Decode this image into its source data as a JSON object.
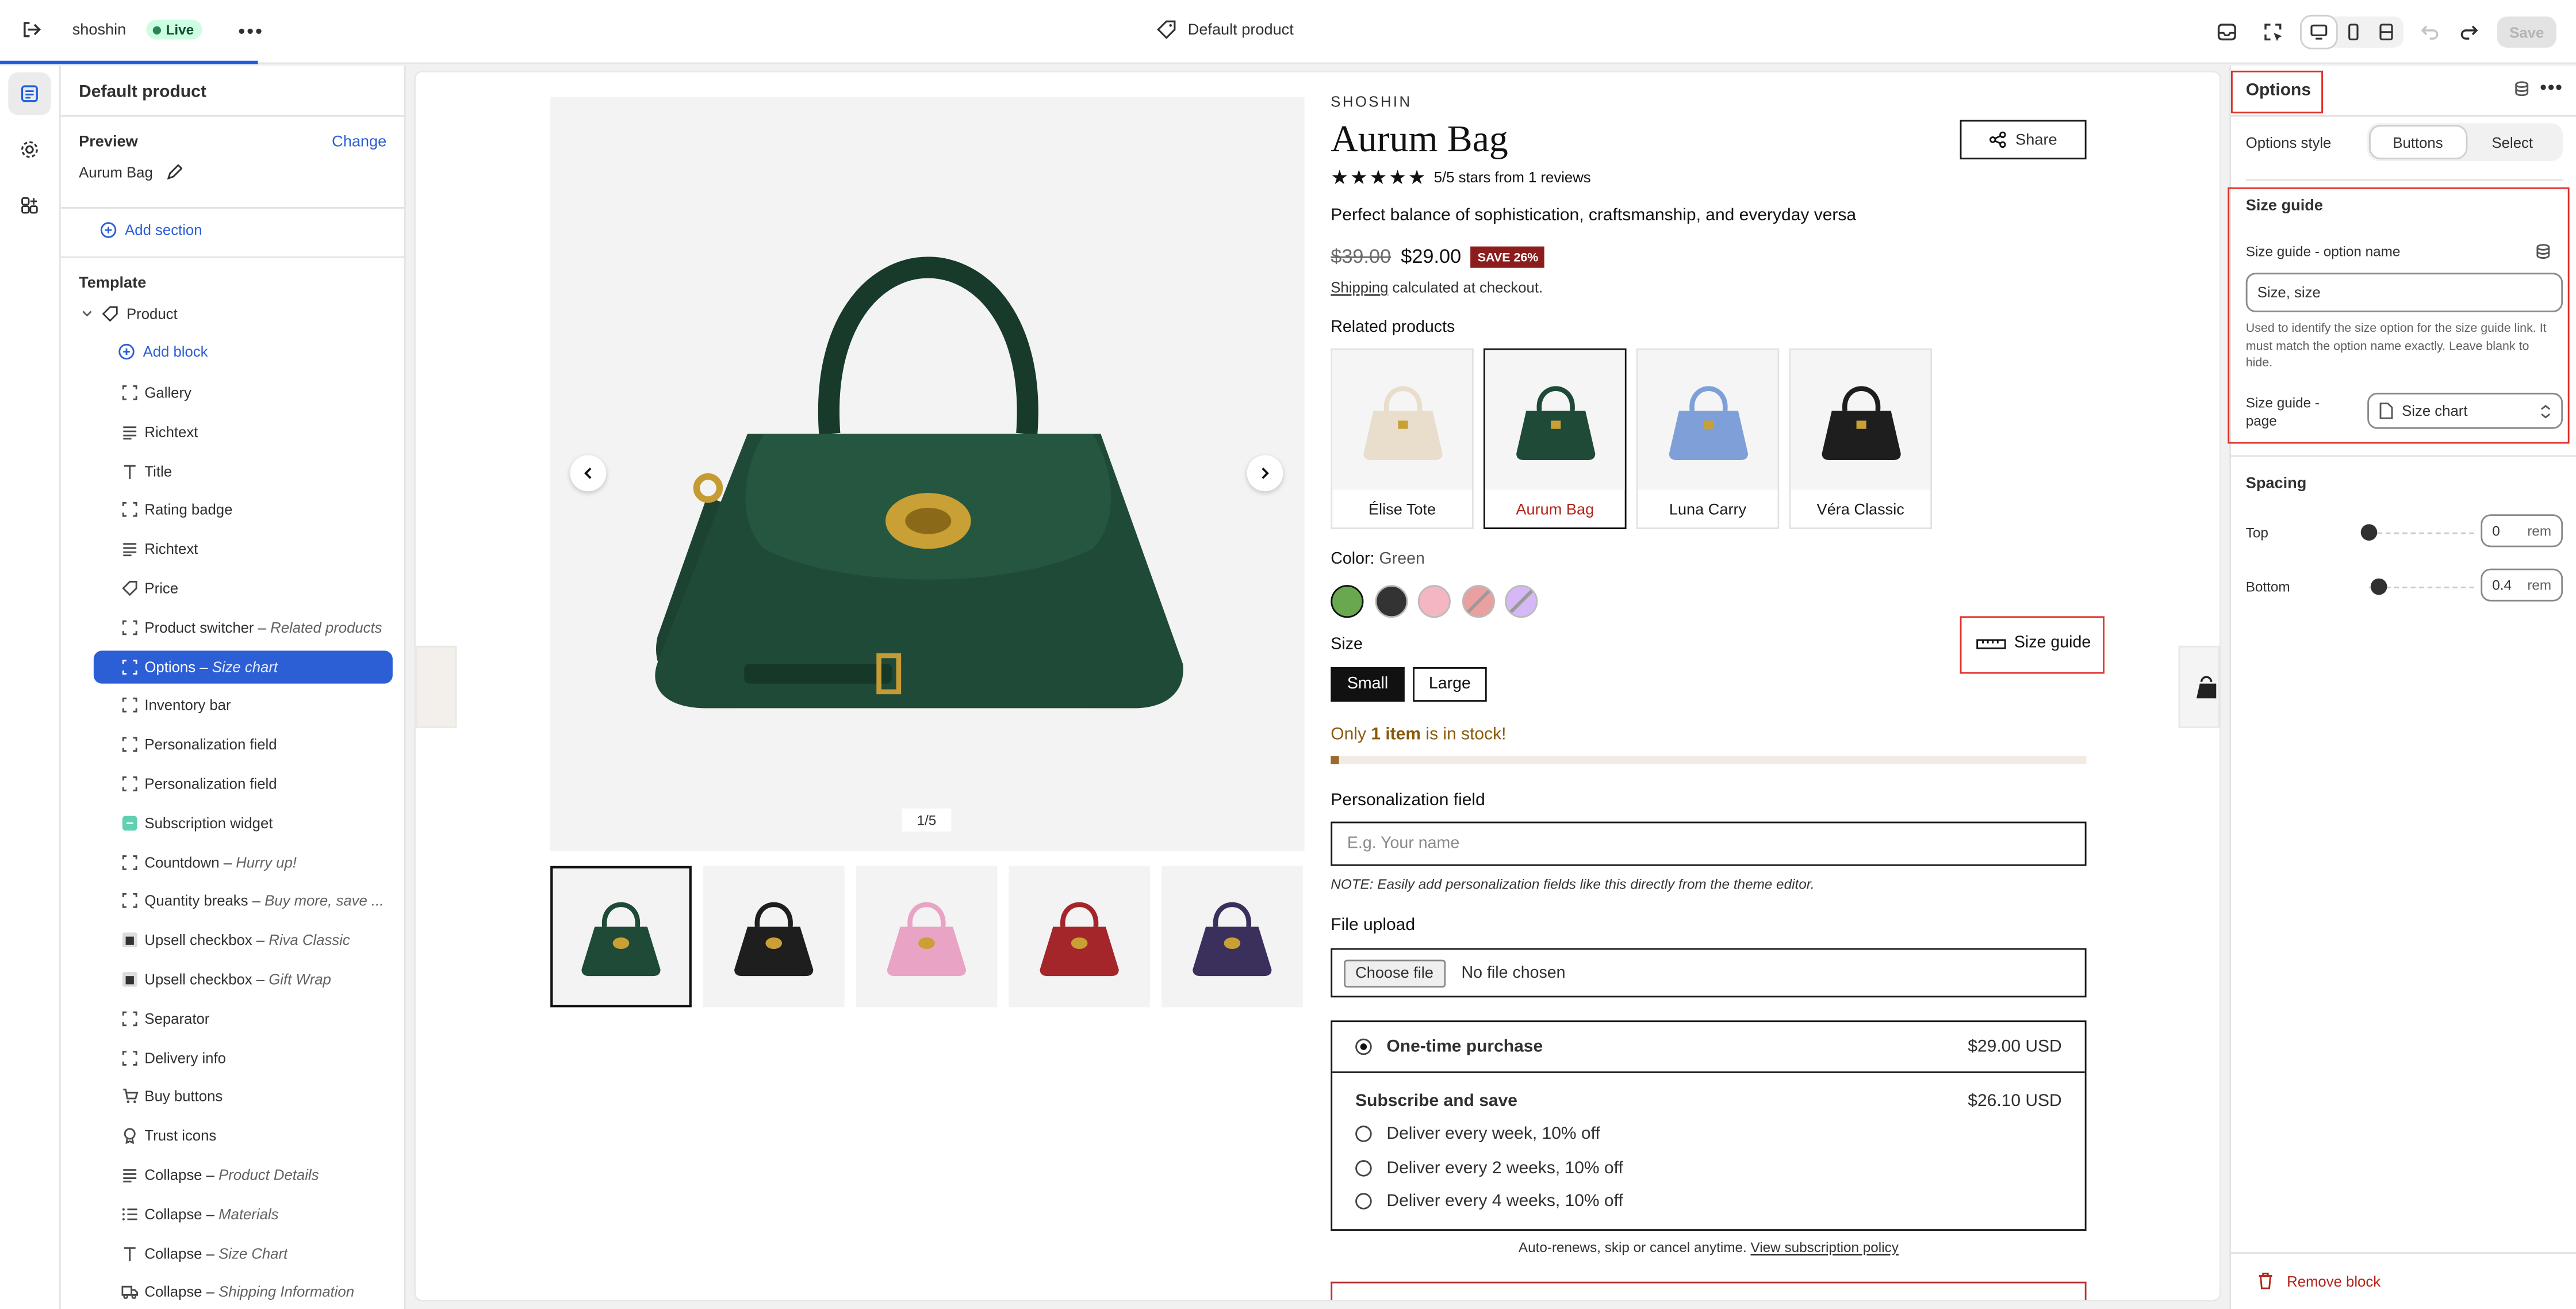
{
  "topbar": {
    "store_name": "shoshin",
    "status_badge": "Live",
    "page_selector": "Default product",
    "save_label": "Save"
  },
  "left_panel": {
    "title": "Default product",
    "preview_label": "Preview",
    "change_link": "Change",
    "preview_product": "Aurum Bag",
    "add_section": "Add section",
    "template_label": "Template",
    "product_label": "Product",
    "add_block": "Add block",
    "blocks": [
      {
        "label": "Gallery",
        "detail": "",
        "icon": "frame-icon"
      },
      {
        "label": "Richtext",
        "detail": "",
        "icon": "text-lines-icon"
      },
      {
        "label": "Title",
        "detail": "",
        "icon": "title-icon"
      },
      {
        "label": "Rating badge",
        "detail": "",
        "icon": "frame-icon"
      },
      {
        "label": "Richtext",
        "detail": "",
        "icon": "text-lines-icon"
      },
      {
        "label": "Price",
        "detail": "",
        "icon": "price-tag-icon"
      },
      {
        "label": "Product switcher",
        "detail": "Related products",
        "icon": "frame-icon"
      },
      {
        "label": "Options",
        "detail": "Size chart",
        "icon": "frame-icon",
        "selected": true
      },
      {
        "label": "Inventory bar",
        "detail": "",
        "icon": "frame-icon"
      },
      {
        "label": "Personalization field",
        "detail": "",
        "icon": "frame-icon"
      },
      {
        "label": "Personalization field",
        "detail": "",
        "icon": "frame-icon"
      },
      {
        "label": "Subscription widget",
        "detail": "",
        "icon": "app-icon"
      },
      {
        "label": "Countdown",
        "detail": "Hurry up!",
        "icon": "frame-icon"
      },
      {
        "label": "Quantity breaks",
        "detail": "Buy more, save ...",
        "icon": "frame-icon"
      },
      {
        "label": "Upsell checkbox",
        "detail": "Riva Classic",
        "icon": "product-icon"
      },
      {
        "label": "Upsell checkbox",
        "detail": "Gift Wrap",
        "icon": "product-icon"
      },
      {
        "label": "Separator",
        "detail": "",
        "icon": "frame-icon"
      },
      {
        "label": "Delivery info",
        "detail": "",
        "icon": "frame-icon"
      },
      {
        "label": "Buy buttons",
        "detail": "",
        "icon": "cart-icon"
      },
      {
        "label": "Trust icons",
        "detail": "",
        "icon": "badge-icon"
      },
      {
        "label": "Collapse",
        "detail": "Product Details",
        "icon": "text-lines-icon"
      },
      {
        "label": "Collapse",
        "detail": "Materials",
        "icon": "list-icon"
      },
      {
        "label": "Collapse",
        "detail": "Size Chart",
        "icon": "title-icon"
      },
      {
        "label": "Collapse",
        "detail": "Shipping Information",
        "icon": "truck-icon"
      }
    ]
  },
  "product": {
    "vendor": "SHOSHIN",
    "title": "Aurum Bag",
    "share_label": "Share",
    "stars": "★★★★★",
    "rating_text": "5/5 stars from 1 reviews",
    "tagline": "Perfect balance of sophistication, craftsmanship, and everyday versa",
    "compare_price": "$39.00",
    "price": "$29.00",
    "save_badge": "SAVE 26%",
    "shipping_link": "Shipping",
    "shipping_text": " calculated at checkout.",
    "related_title": "Related products",
    "related": [
      "Élise Tote",
      "Aurum Bag",
      "Luna Carry",
      "Véra Classic"
    ],
    "color_label": "Color:",
    "color_value": "Green",
    "swatch_colors": [
      "#6aa84f",
      "#333333",
      "#f4b6c2",
      "#e8a0a0",
      "#d5b8f5"
    ],
    "size_label": "Size",
    "sizes": [
      "Small",
      "Large"
    ],
    "size_guide_label": "Size guide",
    "stock_prefix": "Only ",
    "stock_count": "1 item",
    "stock_suffix": " is in stock!",
    "stock_level": 0.01,
    "personalization_label": "Personalization field",
    "personalization_placeholder": "E.g. Your name",
    "note": "NOTE: Easily add personalization fields like this directly from the theme editor.",
    "file_upload_label": "File upload",
    "choose_file": "Choose file",
    "no_file": "No file chosen",
    "one_time_label": "One-time purchase",
    "one_time_price": "$29.00 USD",
    "subscribe_label": "Subscribe and save",
    "subscribe_price": "$26.10 USD",
    "deliveries": [
      "Deliver every week, 10% off",
      "Deliver every 2 weeks, 10% off",
      "Deliver every 4 weeks, 10% off"
    ],
    "autorenew_text": "Auto-renews, skip or cancel anytime. ",
    "policy_link": "View subscription policy",
    "gallery_counter": "1/5",
    "thumb_colors": [
      "#1f4a38",
      "#1e1e1e",
      "#e9a3c4",
      "#a4262a",
      "#3b2f5c"
    ]
  },
  "right_panel": {
    "title": "Options",
    "options_style_label": "Options style",
    "style_buttons": "Buttons",
    "style_select": "Select",
    "size_guide_heading": "Size guide",
    "option_name_label": "Size guide - option name",
    "option_name_value": "Size, size",
    "help_text": "Used to identify the size option for the size guide link. It must match the option name exactly. Leave blank to hide.",
    "page_label": "Size guide - page",
    "page_value": "Size chart",
    "spacing_heading": "Spacing",
    "top_label": "Top",
    "top_value": "0",
    "bottom_label": "Bottom",
    "bottom_value": "0.4",
    "unit": "rem",
    "remove_block": "Remove block"
  }
}
